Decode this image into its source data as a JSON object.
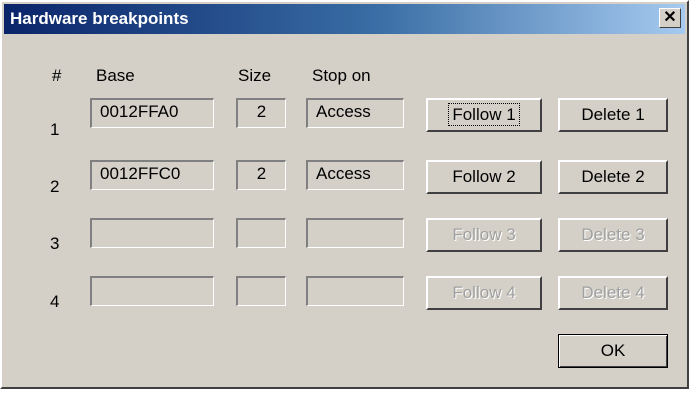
{
  "window": {
    "title": "Hardware breakpoints",
    "close_glyph": "✕"
  },
  "headers": {
    "num": "#",
    "base": "Base",
    "size": "Size",
    "stop_on": "Stop on"
  },
  "rows": [
    {
      "num": "1",
      "base": "0012FFA0",
      "size": "2",
      "stop_on": "Access",
      "follow_label": "Follow 1",
      "delete_label": "Delete 1",
      "enabled": true
    },
    {
      "num": "2",
      "base": "0012FFC0",
      "size": "2",
      "stop_on": "Access",
      "follow_label": "Follow 2",
      "delete_label": "Delete 2",
      "enabled": true
    },
    {
      "num": "3",
      "base": "",
      "size": "",
      "stop_on": "",
      "follow_label": "Follow 3",
      "delete_label": "Delete 3",
      "enabled": false
    },
    {
      "num": "4",
      "base": "",
      "size": "",
      "stop_on": "",
      "follow_label": "Follow 4",
      "delete_label": "Delete 4",
      "enabled": false
    }
  ],
  "ok_label": "OK",
  "colors": {
    "face": "#d4d0c8",
    "title_start": "#0a246a",
    "title_end": "#a6caf0",
    "disabled_text": "#a0a0a0"
  }
}
